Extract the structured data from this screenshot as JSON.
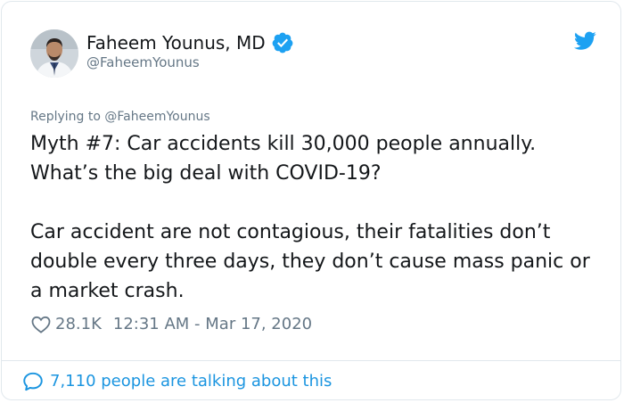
{
  "author": {
    "display_name": "Faheem Younus, MD",
    "handle": "@FaheemYounus",
    "avatar_icon": "profile-photo",
    "verified_icon": "verified-badge-icon"
  },
  "brand": {
    "logo_icon": "twitter-bird-icon",
    "accent_color": "#1da1f2",
    "link_color": "#1b95e0"
  },
  "reply": {
    "text": "Replying to @FaheemYounus"
  },
  "tweet": {
    "paragraph_1": "Myth #7: Car accidents kill 30,000 people annually. What’s the big deal with COVID-19?",
    "paragraph_2": "Car accident are not contagious, their fatalities don’t double every three days, they don’t cause mass panic or a market crash."
  },
  "stats": {
    "likes": "28.1K",
    "timestamp": "12:31 AM - Mar 17, 2020"
  },
  "footer": {
    "talking_text": "7,110 people are talking about this"
  }
}
